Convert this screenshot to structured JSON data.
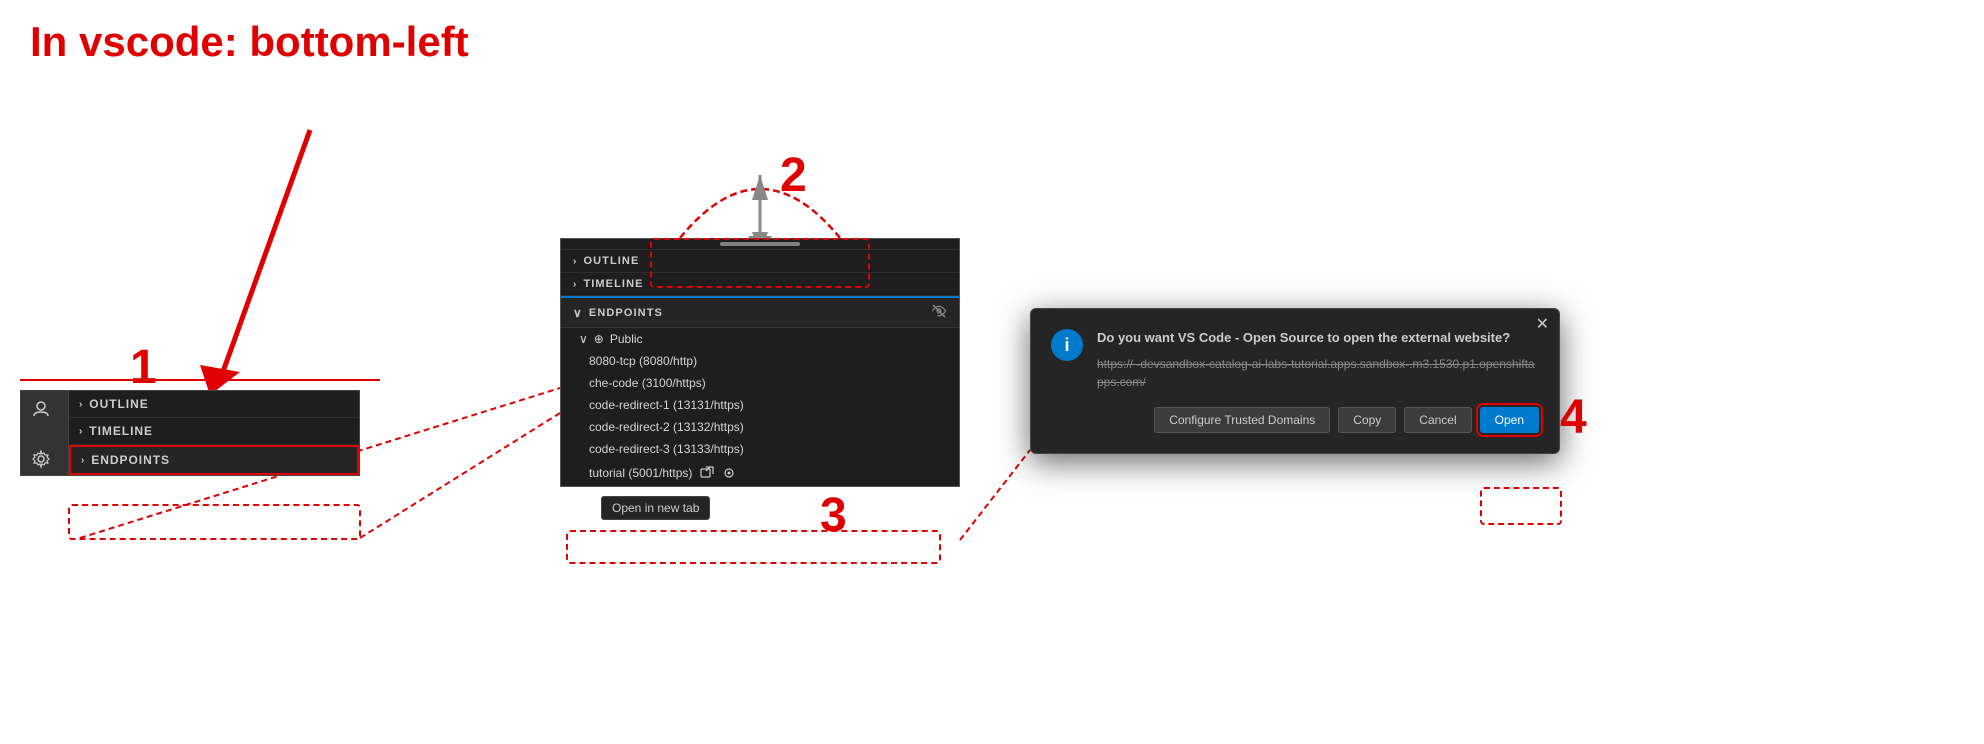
{
  "annotation": {
    "title": "In vscode: bottom-left"
  },
  "numbers": {
    "one": "1",
    "two": "2",
    "three": "3",
    "four": "4"
  },
  "panel1": {
    "outline_label": "OUTLINE",
    "timeline_label": "TIMELINE",
    "endpoints_label": "ENDPOINTS"
  },
  "panel2": {
    "outline_label": "OUTLINE",
    "timeline_label": "TIMELINE",
    "endpoints_label": "ENDPOINTS",
    "public_label": "Public",
    "items": [
      "8080-tcp (8080/http)",
      "che-code (3100/https)",
      "code-redirect-1 (13131/https)",
      "code-redirect-2 (13132/https)",
      "code-redirect-3 (13133/https)",
      "tutorial (5001/https)"
    ]
  },
  "resize_handle": {},
  "tooltip": {
    "label": "Open in new tab"
  },
  "modal": {
    "title": "Do you want VS Code - Open Source to open the external website?",
    "url": "https://              -devsandbox-catalog-ai-labs-tutorial.apps.sandbox-.m3.1530.p1.openshiftapps.com/",
    "btn_configure": "Configure Trusted Domains",
    "btn_copy": "Copy",
    "btn_cancel": "Cancel",
    "btn_open": "Open"
  }
}
